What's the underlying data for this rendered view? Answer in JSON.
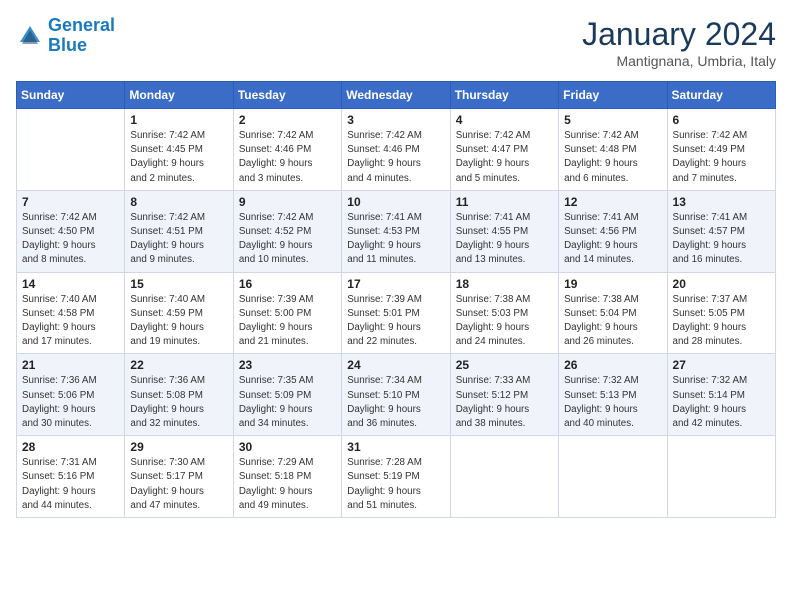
{
  "logo": {
    "line1": "General",
    "line2": "Blue"
  },
  "title": "January 2024",
  "subtitle": "Mantignana, Umbria, Italy",
  "days_of_week": [
    "Sunday",
    "Monday",
    "Tuesday",
    "Wednesday",
    "Thursday",
    "Friday",
    "Saturday"
  ],
  "weeks": [
    [
      {
        "num": "",
        "info": ""
      },
      {
        "num": "1",
        "info": "Sunrise: 7:42 AM\nSunset: 4:45 PM\nDaylight: 9 hours\nand 2 minutes."
      },
      {
        "num": "2",
        "info": "Sunrise: 7:42 AM\nSunset: 4:46 PM\nDaylight: 9 hours\nand 3 minutes."
      },
      {
        "num": "3",
        "info": "Sunrise: 7:42 AM\nSunset: 4:46 PM\nDaylight: 9 hours\nand 4 minutes."
      },
      {
        "num": "4",
        "info": "Sunrise: 7:42 AM\nSunset: 4:47 PM\nDaylight: 9 hours\nand 5 minutes."
      },
      {
        "num": "5",
        "info": "Sunrise: 7:42 AM\nSunset: 4:48 PM\nDaylight: 9 hours\nand 6 minutes."
      },
      {
        "num": "6",
        "info": "Sunrise: 7:42 AM\nSunset: 4:49 PM\nDaylight: 9 hours\nand 7 minutes."
      }
    ],
    [
      {
        "num": "7",
        "info": "Sunrise: 7:42 AM\nSunset: 4:50 PM\nDaylight: 9 hours\nand 8 minutes."
      },
      {
        "num": "8",
        "info": "Sunrise: 7:42 AM\nSunset: 4:51 PM\nDaylight: 9 hours\nand 9 minutes."
      },
      {
        "num": "9",
        "info": "Sunrise: 7:42 AM\nSunset: 4:52 PM\nDaylight: 9 hours\nand 10 minutes."
      },
      {
        "num": "10",
        "info": "Sunrise: 7:41 AM\nSunset: 4:53 PM\nDaylight: 9 hours\nand 11 minutes."
      },
      {
        "num": "11",
        "info": "Sunrise: 7:41 AM\nSunset: 4:55 PM\nDaylight: 9 hours\nand 13 minutes."
      },
      {
        "num": "12",
        "info": "Sunrise: 7:41 AM\nSunset: 4:56 PM\nDaylight: 9 hours\nand 14 minutes."
      },
      {
        "num": "13",
        "info": "Sunrise: 7:41 AM\nSunset: 4:57 PM\nDaylight: 9 hours\nand 16 minutes."
      }
    ],
    [
      {
        "num": "14",
        "info": "Sunrise: 7:40 AM\nSunset: 4:58 PM\nDaylight: 9 hours\nand 17 minutes."
      },
      {
        "num": "15",
        "info": "Sunrise: 7:40 AM\nSunset: 4:59 PM\nDaylight: 9 hours\nand 19 minutes."
      },
      {
        "num": "16",
        "info": "Sunrise: 7:39 AM\nSunset: 5:00 PM\nDaylight: 9 hours\nand 21 minutes."
      },
      {
        "num": "17",
        "info": "Sunrise: 7:39 AM\nSunset: 5:01 PM\nDaylight: 9 hours\nand 22 minutes."
      },
      {
        "num": "18",
        "info": "Sunrise: 7:38 AM\nSunset: 5:03 PM\nDaylight: 9 hours\nand 24 minutes."
      },
      {
        "num": "19",
        "info": "Sunrise: 7:38 AM\nSunset: 5:04 PM\nDaylight: 9 hours\nand 26 minutes."
      },
      {
        "num": "20",
        "info": "Sunrise: 7:37 AM\nSunset: 5:05 PM\nDaylight: 9 hours\nand 28 minutes."
      }
    ],
    [
      {
        "num": "21",
        "info": "Sunrise: 7:36 AM\nSunset: 5:06 PM\nDaylight: 9 hours\nand 30 minutes."
      },
      {
        "num": "22",
        "info": "Sunrise: 7:36 AM\nSunset: 5:08 PM\nDaylight: 9 hours\nand 32 minutes."
      },
      {
        "num": "23",
        "info": "Sunrise: 7:35 AM\nSunset: 5:09 PM\nDaylight: 9 hours\nand 34 minutes."
      },
      {
        "num": "24",
        "info": "Sunrise: 7:34 AM\nSunset: 5:10 PM\nDaylight: 9 hours\nand 36 minutes."
      },
      {
        "num": "25",
        "info": "Sunrise: 7:33 AM\nSunset: 5:12 PM\nDaylight: 9 hours\nand 38 minutes."
      },
      {
        "num": "26",
        "info": "Sunrise: 7:32 AM\nSunset: 5:13 PM\nDaylight: 9 hours\nand 40 minutes."
      },
      {
        "num": "27",
        "info": "Sunrise: 7:32 AM\nSunset: 5:14 PM\nDaylight: 9 hours\nand 42 minutes."
      }
    ],
    [
      {
        "num": "28",
        "info": "Sunrise: 7:31 AM\nSunset: 5:16 PM\nDaylight: 9 hours\nand 44 minutes."
      },
      {
        "num": "29",
        "info": "Sunrise: 7:30 AM\nSunset: 5:17 PM\nDaylight: 9 hours\nand 47 minutes."
      },
      {
        "num": "30",
        "info": "Sunrise: 7:29 AM\nSunset: 5:18 PM\nDaylight: 9 hours\nand 49 minutes."
      },
      {
        "num": "31",
        "info": "Sunrise: 7:28 AM\nSunset: 5:19 PM\nDaylight: 9 hours\nand 51 minutes."
      },
      {
        "num": "",
        "info": ""
      },
      {
        "num": "",
        "info": ""
      },
      {
        "num": "",
        "info": ""
      }
    ]
  ]
}
